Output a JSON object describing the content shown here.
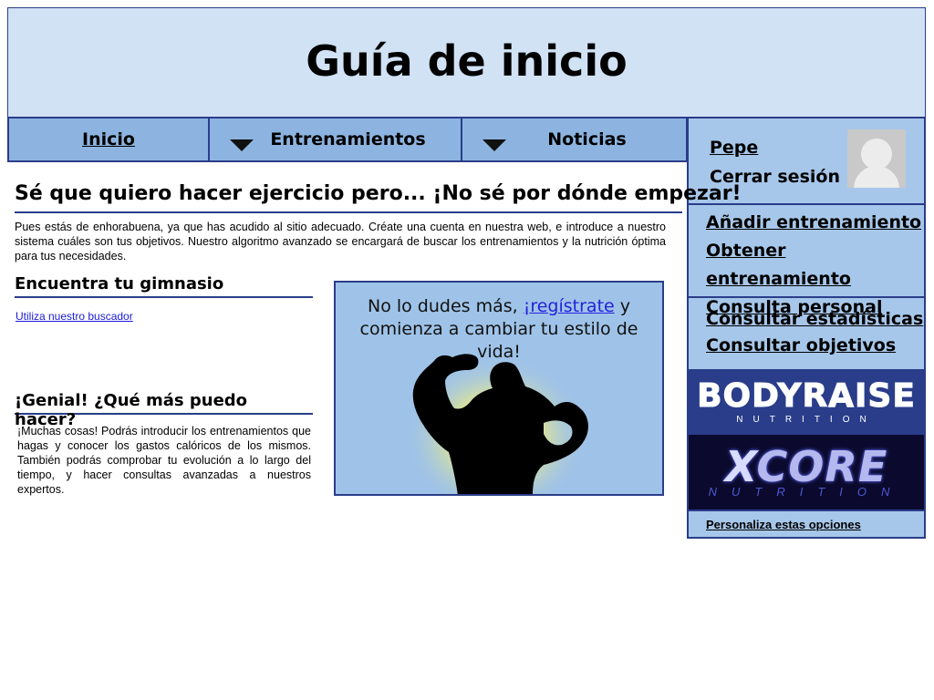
{
  "header": {
    "title": "Guía de inicio"
  },
  "nav": {
    "inicio": "Inicio",
    "entrenamientos": "Entrenamientos",
    "noticias": "Noticias"
  },
  "sidebar": {
    "user_name": "Pepe",
    "logout": "Cerrar sesión",
    "group1": [
      "Añadir entrenamiento",
      "Obtener entrenamiento",
      "Consulta personal"
    ],
    "group2": [
      "Consultar estadísticas",
      "Consultar objetivos"
    ],
    "ads": {
      "bodyraise": {
        "name": "BODYRAISE",
        "tag": "NUTRITION"
      },
      "xcore": {
        "name_x": "X",
        "name_rest": "CORE",
        "tag": "NUTRITION"
      }
    },
    "customize": "Personaliza estas opciones"
  },
  "main": {
    "title": "Sé que quiero hacer ejercicio pero... ¡No sé por dónde empezar!",
    "intro": "Pues estás de enhorabuena, ya que has acudido al sitio adecuado. Créate una cuenta en nuestra web, e introduce a nuestro sistema cuáles son tus objetivos. Nuestro algoritmo avanzado se encargará de buscar los entrenamientos y la nutrición óptima para tus necesidades.",
    "gym_heading": "Encuentra tu gimnasio",
    "gym_link": "Utiliza nuestro buscador",
    "genial_heading": "¡Genial! ¿Qué más puedo hacer?",
    "genial_text": "¡Muchas cosas! Podrás introducir los entrenamientos que hagas y conocer los gastos calóricos de los mismos. También podrás comprobar tu evolución a lo largo del tiempo, y hacer consultas avanzadas a nuestros expertos.",
    "promo": {
      "before": "No lo dudes más, ",
      "link": "¡regístrate",
      "after": " y comienza a cambiar tu estilo de vida!"
    }
  },
  "colors": {
    "header_bg": "#d1e2f5",
    "nav_bg": "#8db4e0",
    "sidebar_bg": "#a7c7ea",
    "border": "#2a3d8a"
  }
}
